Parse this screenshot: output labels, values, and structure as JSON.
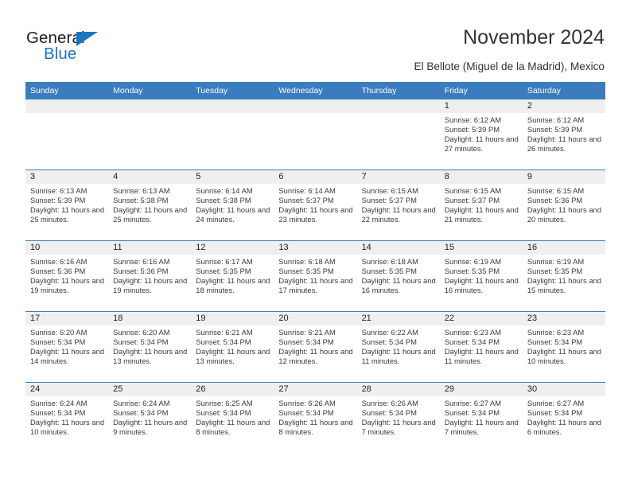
{
  "logo": {
    "word_top": "General",
    "word_bottom": "Blue",
    "triangle_color": "#1b75bc",
    "text_color": "#231f20"
  },
  "header": {
    "title": "November 2024",
    "subtitle": "El Bellote (Miguel de la Madrid), Mexico"
  },
  "colors": {
    "header_blue": "#3b7cbf",
    "daynum_band": "#efefef",
    "row_divider": "#3b7cbf"
  },
  "calendar": {
    "weekdays": [
      "Sunday",
      "Monday",
      "Tuesday",
      "Wednesday",
      "Thursday",
      "Friday",
      "Saturday"
    ],
    "weeks": [
      [
        {
          "day": "",
          "empty": true
        },
        {
          "day": "",
          "empty": true
        },
        {
          "day": "",
          "empty": true
        },
        {
          "day": "",
          "empty": true
        },
        {
          "day": "",
          "empty": true
        },
        {
          "day": "1",
          "sunrise": "Sunrise: 6:12 AM",
          "sunset": "Sunset: 5:39 PM",
          "daylight": "Daylight: 11 hours and 27 minutes."
        },
        {
          "day": "2",
          "sunrise": "Sunrise: 6:12 AM",
          "sunset": "Sunset: 5:39 PM",
          "daylight": "Daylight: 11 hours and 26 minutes."
        }
      ],
      [
        {
          "day": "3",
          "sunrise": "Sunrise: 6:13 AM",
          "sunset": "Sunset: 5:39 PM",
          "daylight": "Daylight: 11 hours and 25 minutes."
        },
        {
          "day": "4",
          "sunrise": "Sunrise: 6:13 AM",
          "sunset": "Sunset: 5:38 PM",
          "daylight": "Daylight: 11 hours and 25 minutes."
        },
        {
          "day": "5",
          "sunrise": "Sunrise: 6:14 AM",
          "sunset": "Sunset: 5:38 PM",
          "daylight": "Daylight: 11 hours and 24 minutes."
        },
        {
          "day": "6",
          "sunrise": "Sunrise: 6:14 AM",
          "sunset": "Sunset: 5:37 PM",
          "daylight": "Daylight: 11 hours and 23 minutes."
        },
        {
          "day": "7",
          "sunrise": "Sunrise: 6:15 AM",
          "sunset": "Sunset: 5:37 PM",
          "daylight": "Daylight: 11 hours and 22 minutes."
        },
        {
          "day": "8",
          "sunrise": "Sunrise: 6:15 AM",
          "sunset": "Sunset: 5:37 PM",
          "daylight": "Daylight: 11 hours and 21 minutes."
        },
        {
          "day": "9",
          "sunrise": "Sunrise: 6:15 AM",
          "sunset": "Sunset: 5:36 PM",
          "daylight": "Daylight: 11 hours and 20 minutes."
        }
      ],
      [
        {
          "day": "10",
          "sunrise": "Sunrise: 6:16 AM",
          "sunset": "Sunset: 5:36 PM",
          "daylight": "Daylight: 11 hours and 19 minutes."
        },
        {
          "day": "11",
          "sunrise": "Sunrise: 6:16 AM",
          "sunset": "Sunset: 5:36 PM",
          "daylight": "Daylight: 11 hours and 19 minutes."
        },
        {
          "day": "12",
          "sunrise": "Sunrise: 6:17 AM",
          "sunset": "Sunset: 5:35 PM",
          "daylight": "Daylight: 11 hours and 18 minutes."
        },
        {
          "day": "13",
          "sunrise": "Sunrise: 6:18 AM",
          "sunset": "Sunset: 5:35 PM",
          "daylight": "Daylight: 11 hours and 17 minutes."
        },
        {
          "day": "14",
          "sunrise": "Sunrise: 6:18 AM",
          "sunset": "Sunset: 5:35 PM",
          "daylight": "Daylight: 11 hours and 16 minutes."
        },
        {
          "day": "15",
          "sunrise": "Sunrise: 6:19 AM",
          "sunset": "Sunset: 5:35 PM",
          "daylight": "Daylight: 11 hours and 16 minutes."
        },
        {
          "day": "16",
          "sunrise": "Sunrise: 6:19 AM",
          "sunset": "Sunset: 5:35 PM",
          "daylight": "Daylight: 11 hours and 15 minutes."
        }
      ],
      [
        {
          "day": "17",
          "sunrise": "Sunrise: 6:20 AM",
          "sunset": "Sunset: 5:34 PM",
          "daylight": "Daylight: 11 hours and 14 minutes."
        },
        {
          "day": "18",
          "sunrise": "Sunrise: 6:20 AM",
          "sunset": "Sunset: 5:34 PM",
          "daylight": "Daylight: 11 hours and 13 minutes."
        },
        {
          "day": "19",
          "sunrise": "Sunrise: 6:21 AM",
          "sunset": "Sunset: 5:34 PM",
          "daylight": "Daylight: 11 hours and 13 minutes."
        },
        {
          "day": "20",
          "sunrise": "Sunrise: 6:21 AM",
          "sunset": "Sunset: 5:34 PM",
          "daylight": "Daylight: 11 hours and 12 minutes."
        },
        {
          "day": "21",
          "sunrise": "Sunrise: 6:22 AM",
          "sunset": "Sunset: 5:34 PM",
          "daylight": "Daylight: 11 hours and 11 minutes."
        },
        {
          "day": "22",
          "sunrise": "Sunrise: 6:23 AM",
          "sunset": "Sunset: 5:34 PM",
          "daylight": "Daylight: 11 hours and 11 minutes."
        },
        {
          "day": "23",
          "sunrise": "Sunrise: 6:23 AM",
          "sunset": "Sunset: 5:34 PM",
          "daylight": "Daylight: 11 hours and 10 minutes."
        }
      ],
      [
        {
          "day": "24",
          "sunrise": "Sunrise: 6:24 AM",
          "sunset": "Sunset: 5:34 PM",
          "daylight": "Daylight: 11 hours and 10 minutes."
        },
        {
          "day": "25",
          "sunrise": "Sunrise: 6:24 AM",
          "sunset": "Sunset: 5:34 PM",
          "daylight": "Daylight: 11 hours and 9 minutes."
        },
        {
          "day": "26",
          "sunrise": "Sunrise: 6:25 AM",
          "sunset": "Sunset: 5:34 PM",
          "daylight": "Daylight: 11 hours and 8 minutes."
        },
        {
          "day": "27",
          "sunrise": "Sunrise: 6:26 AM",
          "sunset": "Sunset: 5:34 PM",
          "daylight": "Daylight: 11 hours and 8 minutes."
        },
        {
          "day": "28",
          "sunrise": "Sunrise: 6:26 AM",
          "sunset": "Sunset: 5:34 PM",
          "daylight": "Daylight: 11 hours and 7 minutes."
        },
        {
          "day": "29",
          "sunrise": "Sunrise: 6:27 AM",
          "sunset": "Sunset: 5:34 PM",
          "daylight": "Daylight: 11 hours and 7 minutes."
        },
        {
          "day": "30",
          "sunrise": "Sunrise: 6:27 AM",
          "sunset": "Sunset: 5:34 PM",
          "daylight": "Daylight: 11 hours and 6 minutes."
        }
      ]
    ]
  }
}
